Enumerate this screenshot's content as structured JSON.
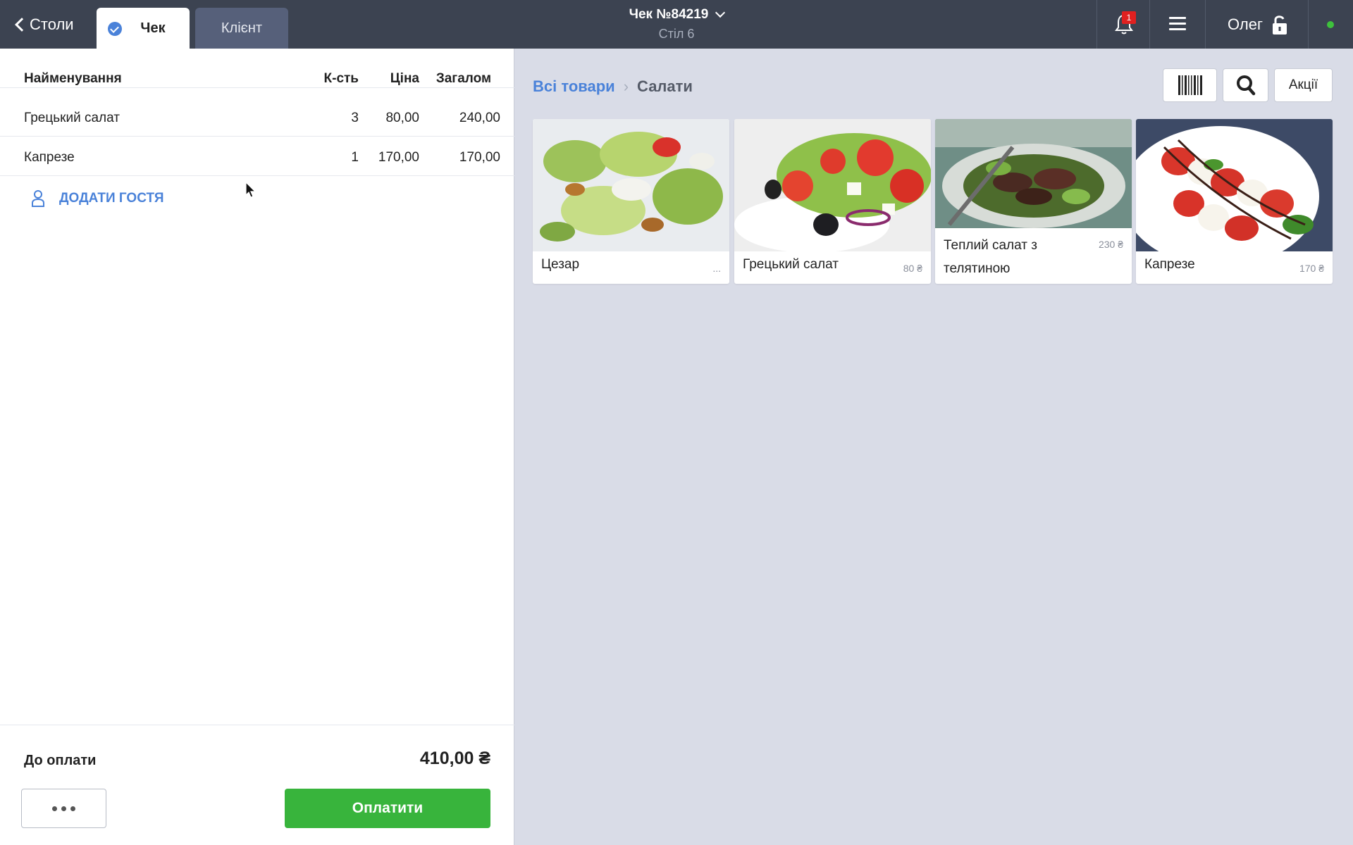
{
  "topbar": {
    "back_label": "Столи",
    "tabs": [
      {
        "label": "Чек",
        "active": true
      },
      {
        "label": "Клієнт",
        "active": false
      }
    ],
    "title": "Чек №84219",
    "subtitle": "Стіл 6",
    "notification_count": "1",
    "user_name": "Олег",
    "status_color": "#3ec13c"
  },
  "order": {
    "headers": {
      "name": "Найменування",
      "qty": "К-сть",
      "price": "Ціна",
      "total": "Загалом"
    },
    "items": [
      {
        "name": "Грецький салат",
        "qty": "3",
        "price": "80,00",
        "total": "240,00"
      },
      {
        "name": "Капрезе",
        "qty": "1",
        "price": "170,00",
        "total": "170,00"
      }
    ],
    "add_guest_label": "ДОДАТИ ГОСТЯ",
    "to_pay_label": "До оплати",
    "to_pay_amount": "410,00 ₴",
    "pay_label": "Оплатити"
  },
  "catalog": {
    "breadcrumb": {
      "root": "Всі товари",
      "separator": "›",
      "current": "Салати"
    },
    "promo_label": "Акції",
    "products": [
      {
        "name": "Цезар",
        "price": "..."
      },
      {
        "name": "Грецький салат",
        "price": "80 ₴"
      },
      {
        "name": "Теплий салат з телятиною",
        "price": "230 ₴"
      },
      {
        "name": "Капрезе",
        "price": "170 ₴"
      }
    ]
  },
  "colors": {
    "accent": "#4a82d9",
    "pay": "#38b43c",
    "topbar": "#3c4351",
    "badge": "#e02020"
  }
}
